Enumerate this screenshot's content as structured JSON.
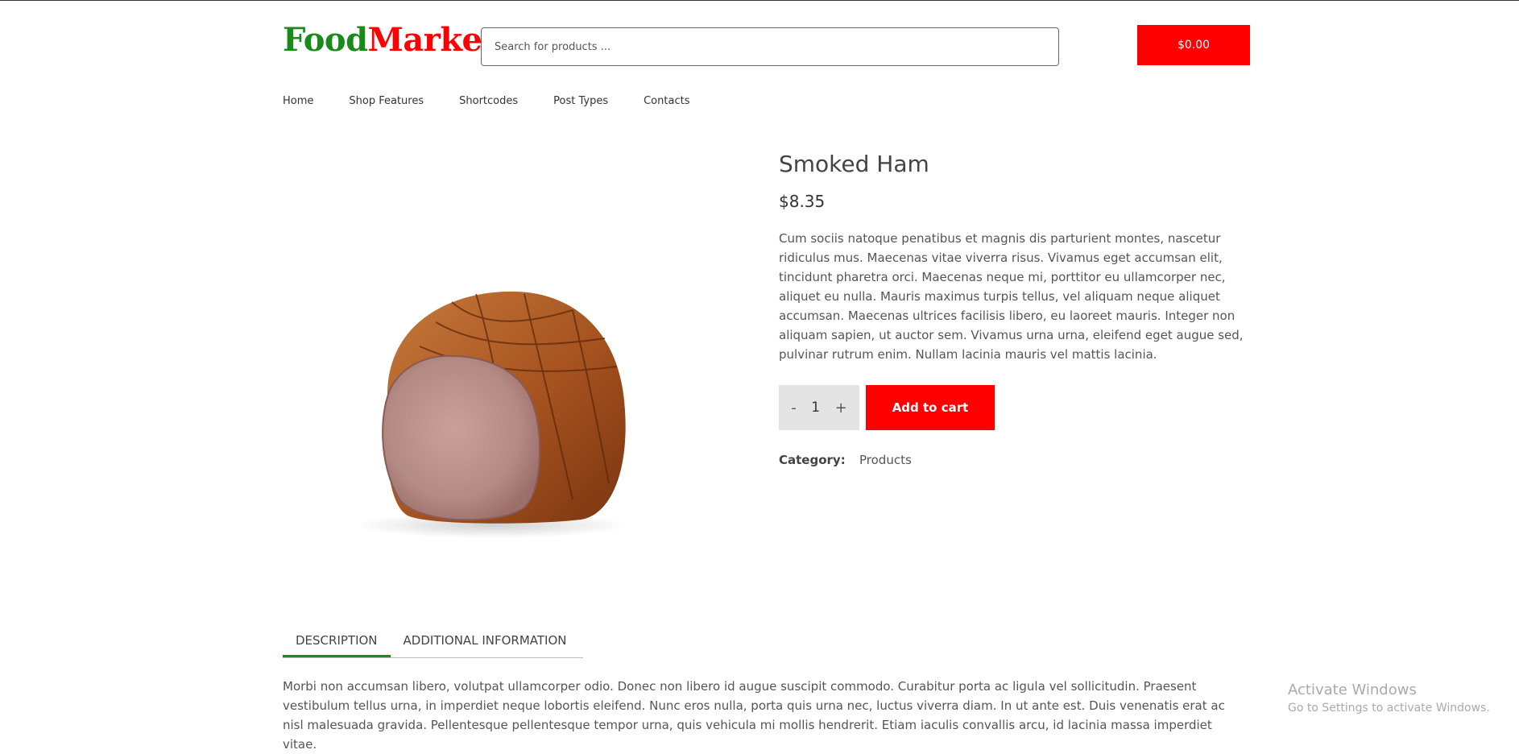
{
  "header": {
    "logo_part1": "Food",
    "logo_part2": "Market",
    "search_placeholder": "Search for products ...",
    "cart_total": "$0.00",
    "colors": {
      "logo_green": "#1a8a1a",
      "accent_red": "#ff0000"
    }
  },
  "nav": {
    "items": [
      "Home",
      "Shop Features",
      "Shortcodes",
      "Post Types",
      "Contacts"
    ]
  },
  "product": {
    "title": "Smoked Ham",
    "price": "$8.35",
    "description": "Cum sociis natoque penatibus et magnis dis parturient montes, nascetur ridiculus mus. Maecenas vitae viverra risus. Vivamus eget accumsan elit, tincidunt pharetra orci. Maecenas neque mi, porttitor eu ullamcorper nec, aliquet eu nulla. Mauris maximus turpis tellus, vel aliquam neque aliquet accumsan. Maecenas ultrices facilisis libero, eu laoreet mauris. Integer non aliquam sapien, ut auctor sem. Vivamus urna urna, eleifend eget augue sed, pulvinar rutrum enim. Nullam lacinia mauris vel mattis lacinia.",
    "quantity": "1",
    "qty_minus": "-",
    "qty_plus": "+",
    "add_to_cart": "Add to cart",
    "category_label": "Category:",
    "category_value": "Products",
    "image_icon": "smoked-ham-image"
  },
  "tabs": {
    "items": [
      "DESCRIPTION",
      "ADDITIONAL INFORMATION"
    ],
    "active": "DESCRIPTION",
    "content": "Morbi non accumsan libero, volutpat ullamcorper odio. Donec non libero id augue suscipit commodo. Curabitur porta ac ligula vel sollicitudin. Praesent vestibulum tellus urna, in imperdiet neque lobortis eleifend. Nunc eros nulla, porta quis urna nec, luctus viverra diam. In ut ante est. Duis venenatis erat ac nisl malesuada gravida. Pellentesque pellentesque tempor urna, quis vehicula mi mollis hendrerit. Etiam iaculis convallis arcu, id lacinia massa imperdiet vitae."
  },
  "watermark": {
    "title": "Activate Windows",
    "subtitle": "Go to Settings to activate Windows."
  }
}
